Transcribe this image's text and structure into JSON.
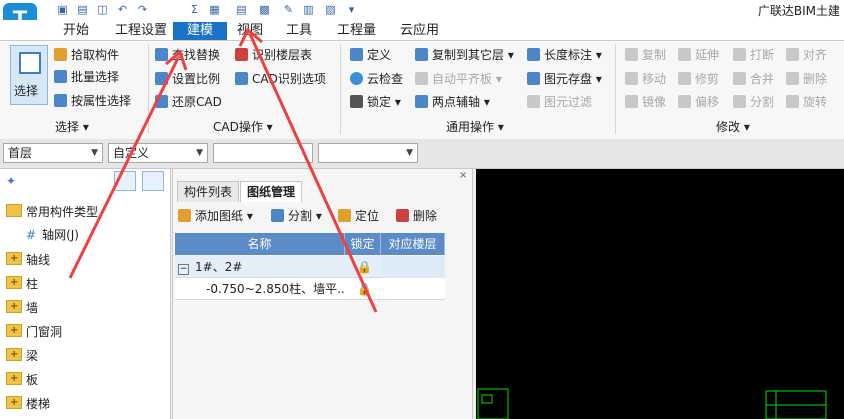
{
  "title": "广联达BIM土建",
  "menu": [
    "开始",
    "工程设置",
    "建模",
    "视图",
    "工具",
    "工程量",
    "云应用"
  ],
  "ribbon": {
    "select_big": "选择",
    "select_items": [
      "拾取构件",
      "批量选择",
      "按属性选择"
    ],
    "select_group": "选择",
    "cad_items": [
      "查找替换",
      "识别楼层表",
      "设置比例",
      "CAD识别选项",
      "还原CAD"
    ],
    "cad_group": "CAD操作",
    "common_col1": [
      "定义",
      "云检查",
      "锁定"
    ],
    "common_col2": [
      "复制到其它层",
      "自动平齐板",
      "两点辅轴"
    ],
    "common_col3": [
      "长度标注",
      "图元存盘",
      "图元过滤"
    ],
    "common_group": "通用操作",
    "modify_col1": [
      "复制",
      "移动",
      "镜像"
    ],
    "modify_col2": [
      "延伸",
      "修剪",
      "偏移"
    ],
    "modify_col3": [
      "打断",
      "合并",
      "分割"
    ],
    "modify_col4": [
      "对齐",
      "删除",
      "旋转"
    ],
    "modify_group": "修改"
  },
  "selectors": {
    "floor": "首层",
    "custom": "自定义",
    "c3": "",
    "c4": ""
  },
  "tree": {
    "header": "常用构件类型",
    "axis_net": "轴网(J)",
    "items": [
      "轴线",
      "柱",
      "墙",
      "门窗洞",
      "梁",
      "板",
      "楼梯"
    ]
  },
  "panel": {
    "tabs": [
      "构件列表",
      "图纸管理"
    ],
    "toolbar": {
      "add": "添加图纸",
      "split": "分割",
      "locate": "定位",
      "delete": "删除"
    },
    "columns": [
      "名称",
      "锁定",
      "对应楼层"
    ],
    "rows": [
      {
        "name": "1#、2#",
        "lock": "🔒",
        "floor": ""
      },
      {
        "name": "-0.750~2.850柱、墙平...",
        "lock": "🔒",
        "floor": ""
      }
    ]
  },
  "colors": {
    "accent": "#1a73c8",
    "arrow": "#ee4040",
    "canvas": "#000000",
    "grid_header": "#5b8cc8"
  }
}
